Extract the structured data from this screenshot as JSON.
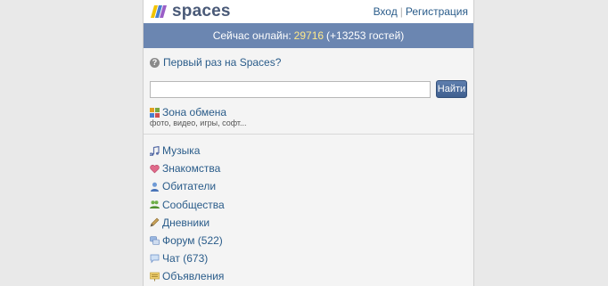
{
  "header": {
    "logo_text": "spaces",
    "login_label": "Вход",
    "separator": "|",
    "register_label": "Регистрация"
  },
  "online_bar": {
    "prefix": "Сейчас онлайн:",
    "count": "29716",
    "guests": "(+13253 гостей)"
  },
  "first_time": {
    "label": "Первый раз на Spaces?"
  },
  "search": {
    "value": "",
    "button_label": "Найти"
  },
  "exchange": {
    "label": "Зона обмена",
    "subtitle": "фото, видео, игры, софт..."
  },
  "menu": [
    {
      "label": "Музыка",
      "icon": "music-note-icon"
    },
    {
      "label": "Знакомства",
      "icon": "heart-icon"
    },
    {
      "label": "Обитатели",
      "icon": "user-icon"
    },
    {
      "label": "Сообщества",
      "icon": "group-icon"
    },
    {
      "label": "Дневники",
      "icon": "pen-icon"
    },
    {
      "label": "Форум (522)",
      "icon": "forum-icon"
    },
    {
      "label": "Чат (673)",
      "icon": "chat-bubble-icon"
    },
    {
      "label": "Объявления",
      "icon": "ads-board-icon"
    }
  ],
  "colors": {
    "link": "#2a5c8a",
    "bar": "#6b86b1",
    "online_count": "#ffe98a",
    "button": "#4a6a9c"
  }
}
